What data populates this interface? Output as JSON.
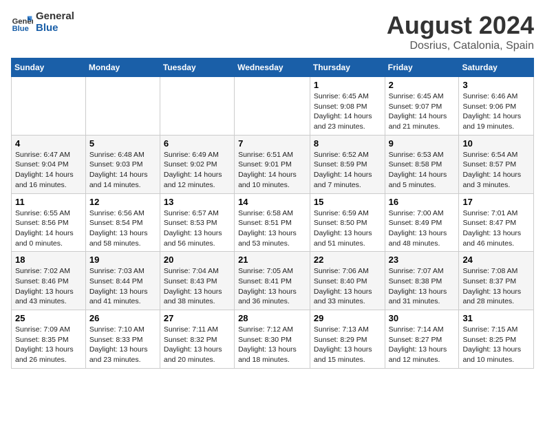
{
  "logo": {
    "line1": "General",
    "line2": "Blue"
  },
  "title": "August 2024",
  "subtitle": "Dosrius, Catalonia, Spain",
  "days_of_week": [
    "Sunday",
    "Monday",
    "Tuesday",
    "Wednesday",
    "Thursday",
    "Friday",
    "Saturday"
  ],
  "weeks": [
    [
      {
        "day": "",
        "info": ""
      },
      {
        "day": "",
        "info": ""
      },
      {
        "day": "",
        "info": ""
      },
      {
        "day": "",
        "info": ""
      },
      {
        "day": "1",
        "info": "Sunrise: 6:45 AM\nSunset: 9:08 PM\nDaylight: 14 hours\nand 23 minutes."
      },
      {
        "day": "2",
        "info": "Sunrise: 6:45 AM\nSunset: 9:07 PM\nDaylight: 14 hours\nand 21 minutes."
      },
      {
        "day": "3",
        "info": "Sunrise: 6:46 AM\nSunset: 9:06 PM\nDaylight: 14 hours\nand 19 minutes."
      }
    ],
    [
      {
        "day": "4",
        "info": "Sunrise: 6:47 AM\nSunset: 9:04 PM\nDaylight: 14 hours\nand 16 minutes."
      },
      {
        "day": "5",
        "info": "Sunrise: 6:48 AM\nSunset: 9:03 PM\nDaylight: 14 hours\nand 14 minutes."
      },
      {
        "day": "6",
        "info": "Sunrise: 6:49 AM\nSunset: 9:02 PM\nDaylight: 14 hours\nand 12 minutes."
      },
      {
        "day": "7",
        "info": "Sunrise: 6:51 AM\nSunset: 9:01 PM\nDaylight: 14 hours\nand 10 minutes."
      },
      {
        "day": "8",
        "info": "Sunrise: 6:52 AM\nSunset: 8:59 PM\nDaylight: 14 hours\nand 7 minutes."
      },
      {
        "day": "9",
        "info": "Sunrise: 6:53 AM\nSunset: 8:58 PM\nDaylight: 14 hours\nand 5 minutes."
      },
      {
        "day": "10",
        "info": "Sunrise: 6:54 AM\nSunset: 8:57 PM\nDaylight: 14 hours\nand 3 minutes."
      }
    ],
    [
      {
        "day": "11",
        "info": "Sunrise: 6:55 AM\nSunset: 8:56 PM\nDaylight: 14 hours\nand 0 minutes."
      },
      {
        "day": "12",
        "info": "Sunrise: 6:56 AM\nSunset: 8:54 PM\nDaylight: 13 hours\nand 58 minutes."
      },
      {
        "day": "13",
        "info": "Sunrise: 6:57 AM\nSunset: 8:53 PM\nDaylight: 13 hours\nand 56 minutes."
      },
      {
        "day": "14",
        "info": "Sunrise: 6:58 AM\nSunset: 8:51 PM\nDaylight: 13 hours\nand 53 minutes."
      },
      {
        "day": "15",
        "info": "Sunrise: 6:59 AM\nSunset: 8:50 PM\nDaylight: 13 hours\nand 51 minutes."
      },
      {
        "day": "16",
        "info": "Sunrise: 7:00 AM\nSunset: 8:49 PM\nDaylight: 13 hours\nand 48 minutes."
      },
      {
        "day": "17",
        "info": "Sunrise: 7:01 AM\nSunset: 8:47 PM\nDaylight: 13 hours\nand 46 minutes."
      }
    ],
    [
      {
        "day": "18",
        "info": "Sunrise: 7:02 AM\nSunset: 8:46 PM\nDaylight: 13 hours\nand 43 minutes."
      },
      {
        "day": "19",
        "info": "Sunrise: 7:03 AM\nSunset: 8:44 PM\nDaylight: 13 hours\nand 41 minutes."
      },
      {
        "day": "20",
        "info": "Sunrise: 7:04 AM\nSunset: 8:43 PM\nDaylight: 13 hours\nand 38 minutes."
      },
      {
        "day": "21",
        "info": "Sunrise: 7:05 AM\nSunset: 8:41 PM\nDaylight: 13 hours\nand 36 minutes."
      },
      {
        "day": "22",
        "info": "Sunrise: 7:06 AM\nSunset: 8:40 PM\nDaylight: 13 hours\nand 33 minutes."
      },
      {
        "day": "23",
        "info": "Sunrise: 7:07 AM\nSunset: 8:38 PM\nDaylight: 13 hours\nand 31 minutes."
      },
      {
        "day": "24",
        "info": "Sunrise: 7:08 AM\nSunset: 8:37 PM\nDaylight: 13 hours\nand 28 minutes."
      }
    ],
    [
      {
        "day": "25",
        "info": "Sunrise: 7:09 AM\nSunset: 8:35 PM\nDaylight: 13 hours\nand 26 minutes."
      },
      {
        "day": "26",
        "info": "Sunrise: 7:10 AM\nSunset: 8:33 PM\nDaylight: 13 hours\nand 23 minutes."
      },
      {
        "day": "27",
        "info": "Sunrise: 7:11 AM\nSunset: 8:32 PM\nDaylight: 13 hours\nand 20 minutes."
      },
      {
        "day": "28",
        "info": "Sunrise: 7:12 AM\nSunset: 8:30 PM\nDaylight: 13 hours\nand 18 minutes."
      },
      {
        "day": "29",
        "info": "Sunrise: 7:13 AM\nSunset: 8:29 PM\nDaylight: 13 hours\nand 15 minutes."
      },
      {
        "day": "30",
        "info": "Sunrise: 7:14 AM\nSunset: 8:27 PM\nDaylight: 13 hours\nand 12 minutes."
      },
      {
        "day": "31",
        "info": "Sunrise: 7:15 AM\nSunset: 8:25 PM\nDaylight: 13 hours\nand 10 minutes."
      }
    ]
  ]
}
